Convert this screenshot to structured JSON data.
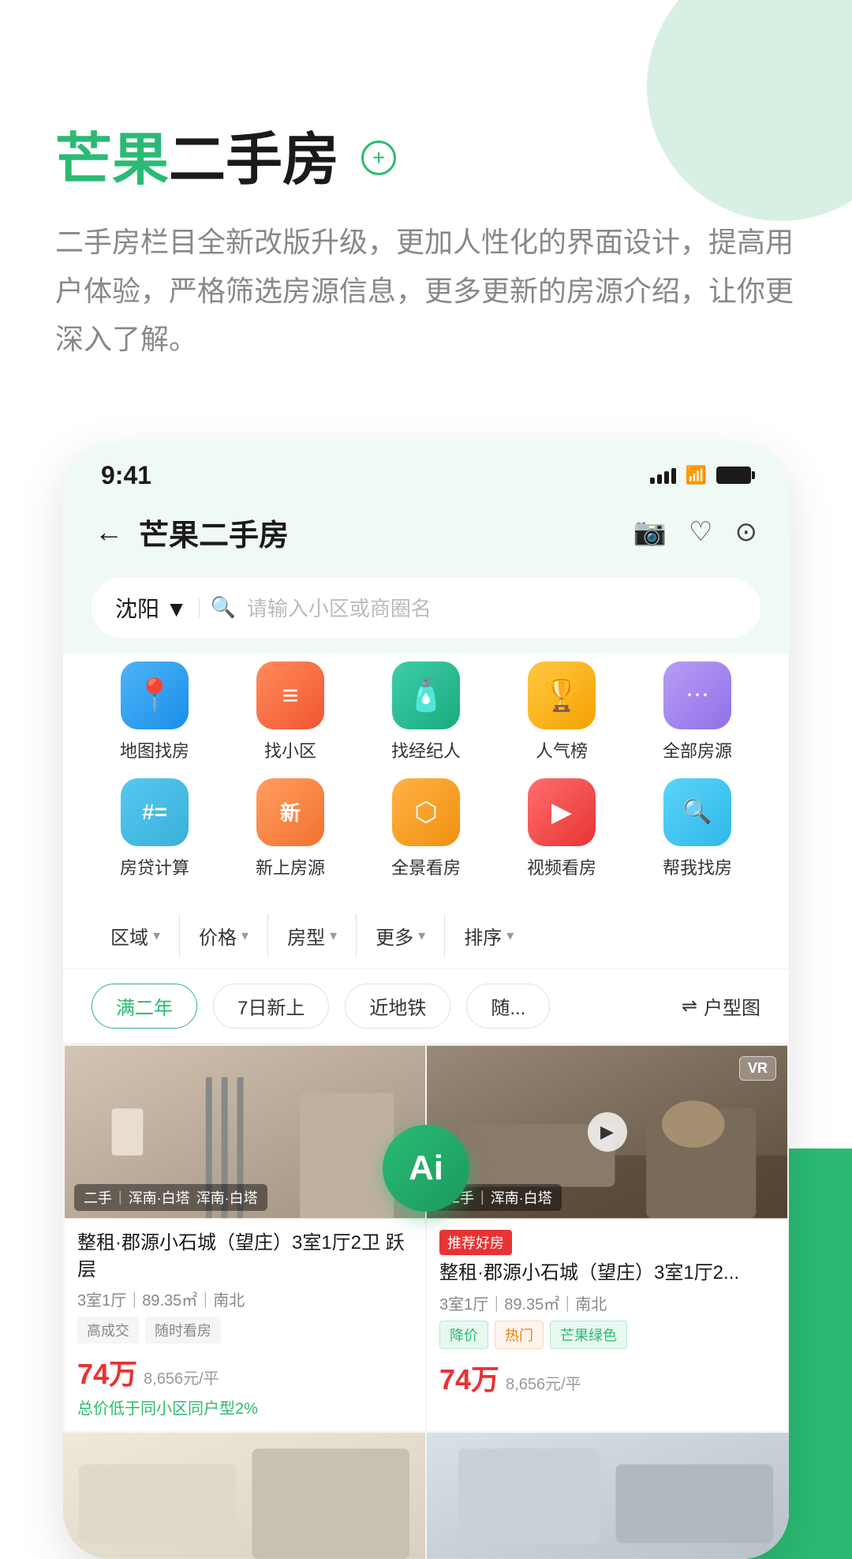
{
  "app": {
    "title": "芒果二手房",
    "description": "二手房栏目全新改版升级，更加人性化的界面设计，提高用户体验，严格筛选房源信息，更多更新的房源介绍，让你更深入了解。"
  },
  "status_bar": {
    "time": "9:41",
    "signal_bars": [
      8,
      12,
      16,
      20
    ],
    "wifi": "wifi",
    "battery": "battery"
  },
  "header": {
    "back_label": "←",
    "title": "芒果二手房",
    "camera_icon": "📷",
    "heart_icon": "♡",
    "message_icon": "💬"
  },
  "search": {
    "location": "沈阳 ▼",
    "placeholder": "请输入小区或商圈名"
  },
  "categories_row1": [
    {
      "id": "map-find",
      "label": "地图找房",
      "icon": "📍",
      "color": "cat-blue"
    },
    {
      "id": "find-community",
      "label": "找小区",
      "icon": "≡",
      "color": "cat-orange"
    },
    {
      "id": "find-agent",
      "label": "找经纪人",
      "icon": "👔",
      "color": "cat-teal"
    },
    {
      "id": "popular",
      "label": "人气榜",
      "icon": "🏆",
      "color": "cat-gold"
    },
    {
      "id": "all-houses",
      "label": "全部房源",
      "icon": "⋯",
      "color": "cat-purple"
    }
  ],
  "categories_row2": [
    {
      "id": "mortgage",
      "label": "房贷计算",
      "icon": "#",
      "color": "cat-green-blue"
    },
    {
      "id": "new-listing",
      "label": "新上房源",
      "icon": "新",
      "color": "cat-orange2"
    },
    {
      "id": "panorama",
      "label": "全景看房",
      "icon": "⬡",
      "color": "cat-orange3"
    },
    {
      "id": "video",
      "label": "视频看房",
      "icon": "▶",
      "color": "cat-red-play"
    },
    {
      "id": "help-find",
      "label": "帮我找房",
      "icon": "🔍",
      "color": "cat-cyan"
    }
  ],
  "filters": [
    {
      "id": "area",
      "label": "区域"
    },
    {
      "id": "price",
      "label": "价格"
    },
    {
      "id": "room-type",
      "label": "房型"
    },
    {
      "id": "more",
      "label": "更多"
    },
    {
      "id": "sort",
      "label": "排序"
    }
  ],
  "quick_filters": [
    {
      "id": "two-years",
      "label": "满二年",
      "active": true
    },
    {
      "id": "seven-days",
      "label": "7日新上",
      "active": false
    },
    {
      "id": "near-metro",
      "label": "近地铁",
      "active": false
    },
    {
      "id": "random",
      "label": "随...",
      "active": false
    }
  ],
  "floor_plan": "户型图",
  "listings": [
    {
      "id": "listing-1",
      "img_color": "#c8b8a8",
      "img_color2": "#a89888",
      "tag": "二手",
      "location": "浑南·白塔",
      "title": "整租·郡源小石城（望庄）3室1厅2卫 跃层",
      "meta": "3室1厅｜89.35㎡｜南北",
      "tags": [
        {
          "label": "高成交",
          "type": "gray"
        },
        {
          "label": "随时看房",
          "type": "gray"
        }
      ],
      "price": "74万",
      "price_per": "8,656元/平",
      "note": "总价低于同小区同户型2%",
      "recommend": false,
      "has_vr": false,
      "has_play": false
    },
    {
      "id": "listing-2",
      "img_color": "#8a7a6a",
      "img_color2": "#6a5a4a",
      "tag": "二手",
      "location": "浑南·白塔",
      "title": "整租·郡源小石城（望庄）3室1厅2...",
      "meta": "3室1厅｜89.35㎡｜南北",
      "tags": [
        {
          "label": "降价",
          "type": "green"
        },
        {
          "label": "热门",
          "type": "orange"
        },
        {
          "label": "芒果绿色",
          "type": "green"
        }
      ],
      "price": "74万",
      "price_per": "8,656元/平",
      "note": "",
      "recommend": true,
      "has_vr": true,
      "has_play": true
    }
  ],
  "bottom_cards": [
    {
      "id": "bottom-1",
      "img_color": "#e8e0d0",
      "img_color2": "#d0c8b8"
    },
    {
      "id": "bottom-2",
      "img_color": "#d0d8e0",
      "img_color2": "#b8c0c8"
    }
  ],
  "ai_badge": "Ai",
  "colors": {
    "primary_green": "#2bba74",
    "price_red": "#e83333",
    "gray_text": "#888888"
  }
}
